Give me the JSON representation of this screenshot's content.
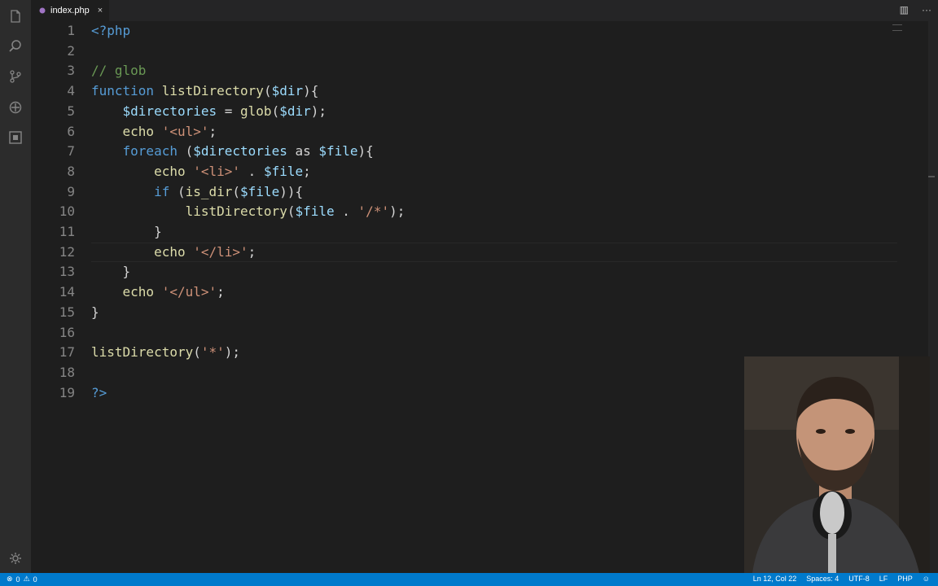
{
  "colors": {
    "accent": "#007acc",
    "editor_bg": "#1e1e1e",
    "activity_bg": "#2c2c2c",
    "keyword": "#569cd6",
    "function": "#dcdcaa",
    "variable": "#9cdcfe",
    "string": "#ce9178",
    "comment": "#6a9955"
  },
  "activity_bar": {
    "icons": [
      "explorer-icon",
      "search-icon",
      "source-control-icon",
      "debug-icon",
      "extensions-icon",
      "settings-gear-icon"
    ]
  },
  "tab": {
    "label": "index.php",
    "close": "×",
    "icon": "php-file-icon"
  },
  "tab_actions": {
    "split": "▥",
    "more": "···"
  },
  "editor": {
    "lines": [
      {
        "n": "1",
        "tokens": [
          {
            "t": "<?php",
            "c": "kw"
          }
        ]
      },
      {
        "n": "2",
        "tokens": []
      },
      {
        "n": "3",
        "tokens": [
          {
            "t": "// glob",
            "c": "cm"
          }
        ]
      },
      {
        "n": "4",
        "tokens": [
          {
            "t": "function ",
            "c": "kw"
          },
          {
            "t": "listDirectory",
            "c": "fn"
          },
          {
            "t": "(",
            "c": "pl"
          },
          {
            "t": "$dir",
            "c": "var"
          },
          {
            "t": "){",
            "c": "pl"
          }
        ]
      },
      {
        "n": "5",
        "tokens": [
          {
            "t": "    ",
            "c": "pl"
          },
          {
            "t": "$directories",
            "c": "var"
          },
          {
            "t": " = ",
            "c": "pl"
          },
          {
            "t": "glob",
            "c": "fn"
          },
          {
            "t": "(",
            "c": "pl"
          },
          {
            "t": "$dir",
            "c": "var"
          },
          {
            "t": ");",
            "c": "pl"
          }
        ]
      },
      {
        "n": "6",
        "tokens": [
          {
            "t": "    ",
            "c": "pl"
          },
          {
            "t": "echo ",
            "c": "fn"
          },
          {
            "t": "'<ul>'",
            "c": "str"
          },
          {
            "t": ";",
            "c": "pl"
          }
        ]
      },
      {
        "n": "7",
        "tokens": [
          {
            "t": "    ",
            "c": "pl"
          },
          {
            "t": "foreach ",
            "c": "kw"
          },
          {
            "t": "(",
            "c": "pl"
          },
          {
            "t": "$directories",
            "c": "var"
          },
          {
            "t": " as ",
            "c": "pl"
          },
          {
            "t": "$file",
            "c": "var"
          },
          {
            "t": "){",
            "c": "pl"
          }
        ]
      },
      {
        "n": "8",
        "tokens": [
          {
            "t": "        ",
            "c": "pl"
          },
          {
            "t": "echo ",
            "c": "fn"
          },
          {
            "t": "'<li>'",
            "c": "str"
          },
          {
            "t": " . ",
            "c": "pl"
          },
          {
            "t": "$file",
            "c": "var"
          },
          {
            "t": ";",
            "c": "pl"
          }
        ]
      },
      {
        "n": "9",
        "tokens": [
          {
            "t": "        ",
            "c": "pl"
          },
          {
            "t": "if ",
            "c": "kw"
          },
          {
            "t": "(",
            "c": "pl"
          },
          {
            "t": "is_dir",
            "c": "fn"
          },
          {
            "t": "(",
            "c": "pl"
          },
          {
            "t": "$file",
            "c": "var"
          },
          {
            "t": ")){",
            "c": "pl"
          }
        ]
      },
      {
        "n": "10",
        "tokens": [
          {
            "t": "            ",
            "c": "pl"
          },
          {
            "t": "listDirectory",
            "c": "fn"
          },
          {
            "t": "(",
            "c": "pl"
          },
          {
            "t": "$file",
            "c": "var"
          },
          {
            "t": " . ",
            "c": "pl"
          },
          {
            "t": "'/*'",
            "c": "str"
          },
          {
            "t": ");",
            "c": "pl"
          }
        ]
      },
      {
        "n": "11",
        "tokens": [
          {
            "t": "        }",
            "c": "pl"
          }
        ]
      },
      {
        "n": "12",
        "tokens": [
          {
            "t": "        ",
            "c": "pl"
          },
          {
            "t": "echo ",
            "c": "fn"
          },
          {
            "t": "'</li>'",
            "c": "str"
          },
          {
            "t": ";",
            "c": "pl"
          }
        ]
      },
      {
        "n": "13",
        "tokens": [
          {
            "t": "    }",
            "c": "pl"
          }
        ]
      },
      {
        "n": "14",
        "tokens": [
          {
            "t": "    ",
            "c": "pl"
          },
          {
            "t": "echo ",
            "c": "fn"
          },
          {
            "t": "'</ul>'",
            "c": "str"
          },
          {
            "t": ";",
            "c": "pl"
          }
        ]
      },
      {
        "n": "15",
        "tokens": [
          {
            "t": "}",
            "c": "pl"
          }
        ]
      },
      {
        "n": "16",
        "tokens": []
      },
      {
        "n": "17",
        "tokens": [
          {
            "t": "listDirectory",
            "c": "fn"
          },
          {
            "t": "(",
            "c": "pl"
          },
          {
            "t": "'*'",
            "c": "str"
          },
          {
            "t": ");",
            "c": "pl"
          }
        ]
      },
      {
        "n": "18",
        "tokens": []
      },
      {
        "n": "19",
        "tokens": [
          {
            "t": "?>",
            "c": "kw"
          }
        ]
      }
    ]
  },
  "status": {
    "errors": "0",
    "warnings": "0",
    "position": "Ln 12, Col 22",
    "spaces": "Spaces: 4",
    "encoding": "UTF-8",
    "eol": "LF",
    "language": "PHP"
  }
}
